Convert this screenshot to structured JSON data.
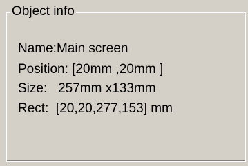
{
  "group": {
    "title": "Object info",
    "lines": [
      "Name:Main screen",
      "Position: [20mm ,20mm ]",
      "Size:   257mm x133mm",
      "Rect:  [20,20,277,153] mm"
    ]
  }
}
